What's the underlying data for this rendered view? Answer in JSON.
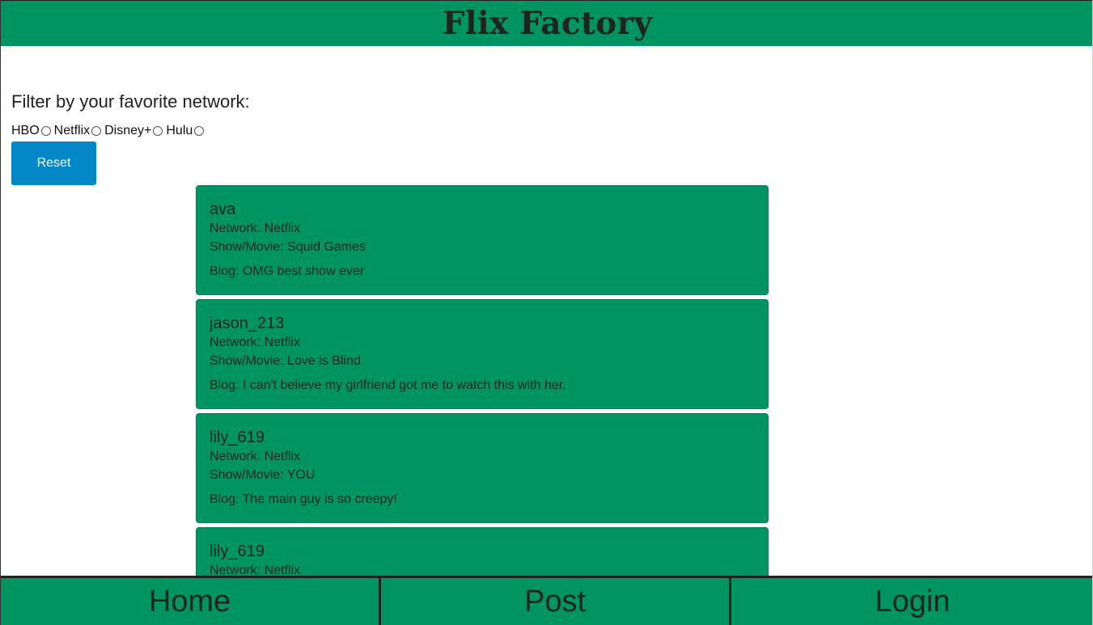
{
  "app": {
    "title": "Flix Factory"
  },
  "filter": {
    "heading": "Filter by your favorite network:",
    "options": [
      {
        "label": "HBO",
        "selected": false
      },
      {
        "label": "Netflix",
        "selected": false
      },
      {
        "label": "Disney+",
        "selected": false
      },
      {
        "label": "Hulu",
        "selected": false
      }
    ],
    "reset_label": "Reset"
  },
  "posts": [
    {
      "user": "ava",
      "network": "Network: Netflix",
      "show": "Show/Movie: Squid Games",
      "blog": "Blog: OMG best show ever"
    },
    {
      "user": "jason_213",
      "network": "Network: Netflix",
      "show": "Show/Movie: Love is Blind",
      "blog": "Blog: I can't believe my girlfriend got me to watch this with her."
    },
    {
      "user": "lily_619",
      "network": "Network: Netflix",
      "show": "Show/Movie: YOU",
      "blog": "Blog: The main guy is so creepy!"
    },
    {
      "user": "lily_619",
      "network": "Network: Netflix",
      "show": "",
      "blog": ""
    }
  ],
  "nav": {
    "home": "Home",
    "post": "Post",
    "login": "Login"
  },
  "colors": {
    "brand_green": "#009463",
    "button_blue": "#0288c6",
    "text_dark": "#1c2424"
  }
}
